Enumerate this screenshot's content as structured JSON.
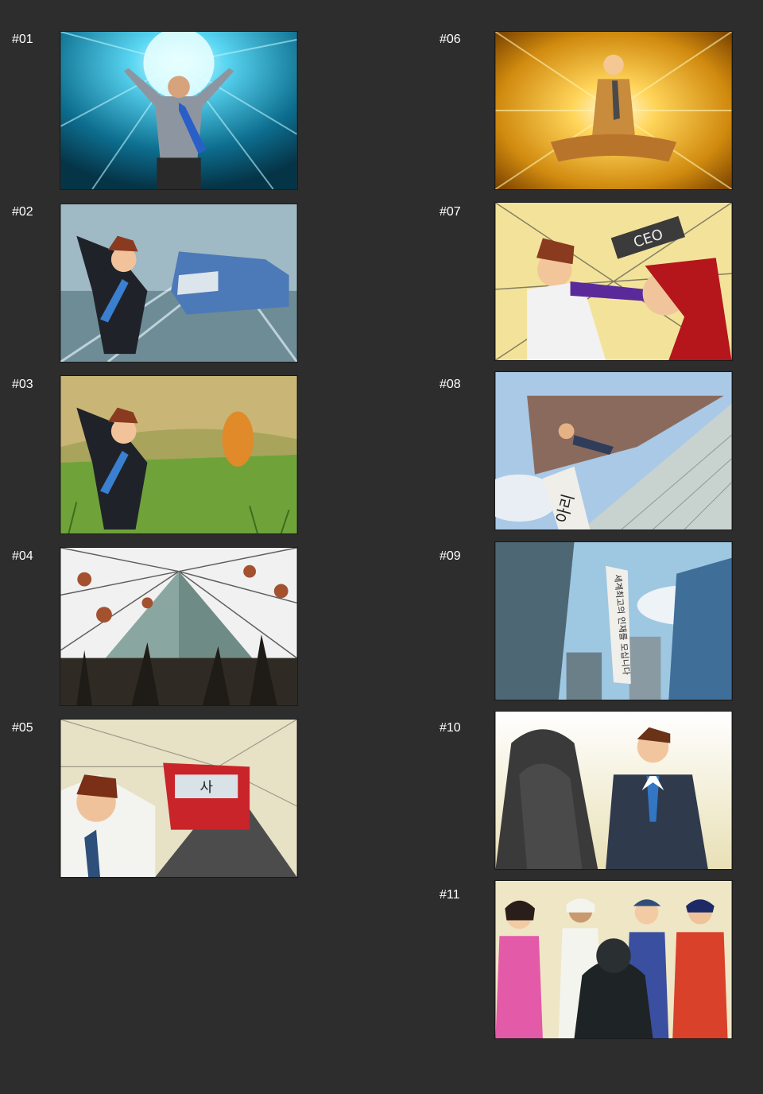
{
  "panels": [
    {
      "label": "#01"
    },
    {
      "label": "#02"
    },
    {
      "label": "#03"
    },
    {
      "label": "#04"
    },
    {
      "label": "#05"
    },
    {
      "label": "#06"
    },
    {
      "label": "#07"
    },
    {
      "label": "#08"
    },
    {
      "label": "#09"
    },
    {
      "label": "#10"
    },
    {
      "label": "#11"
    }
  ],
  "text_in_art": {
    "ceo_sign": "CEO",
    "bus_sign": "사",
    "banner_08": "아리",
    "banner_09": "세계최고의 인재를 모십니다"
  }
}
